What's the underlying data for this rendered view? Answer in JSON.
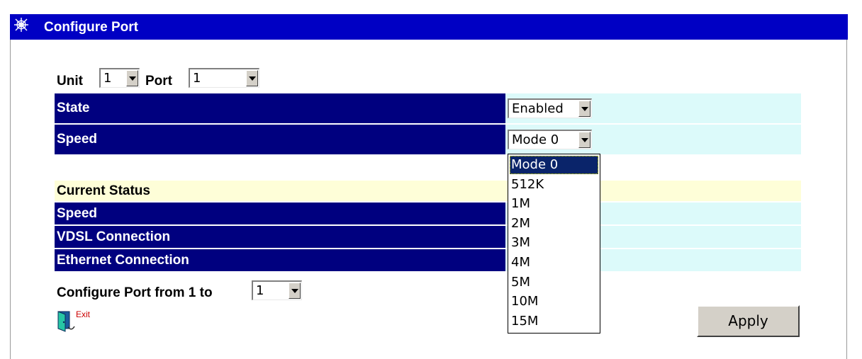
{
  "header": {
    "title": "Configure Port",
    "icon": "web-icon"
  },
  "selectors": {
    "unit_label": "Unit",
    "unit_value": "1",
    "port_label": "Port",
    "port_value": "1"
  },
  "config_rows": [
    {
      "label": "State",
      "value": "Enabled"
    },
    {
      "label": "Speed",
      "value": "Mode 0"
    }
  ],
  "speed_options": [
    "Mode 0",
    "512K",
    "1M",
    "2M",
    "3M",
    "4M",
    "5M",
    "10M",
    "15M"
  ],
  "speed_selected": "Mode 0",
  "status": {
    "header": "Current Status",
    "rows": [
      {
        "label": "Speed",
        "value": ""
      },
      {
        "label": "VDSL Connection",
        "value": ""
      },
      {
        "label": "Ethernet Connection",
        "value": ""
      }
    ]
  },
  "footer": {
    "range_label": "Configure Port from 1 to",
    "range_value": "1",
    "exit_label": "Exit",
    "apply_label": "Apply"
  },
  "colors": {
    "title_bar": "#0000c4",
    "row_label_bg": "#00007f",
    "row_value_bg": "#dcfafa",
    "status_header_bg": "#fefed8",
    "selected_option_bg": "#0a246a"
  }
}
